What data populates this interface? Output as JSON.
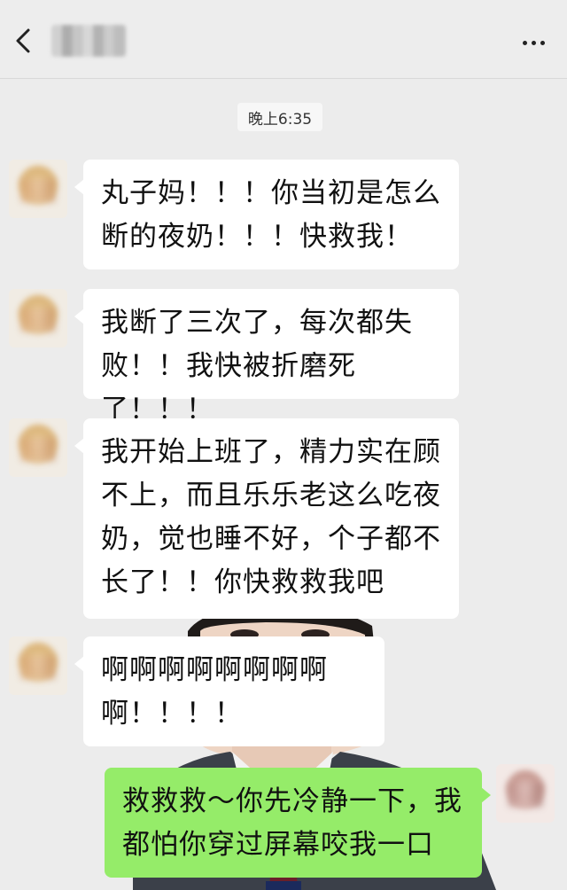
{
  "header": {
    "back_icon": "chevron-left-icon",
    "contact_name": "",
    "more_icon": "more-dots-icon"
  },
  "timestamp": "晚上6:35",
  "messages": [
    {
      "side": "left",
      "text": "丸子妈！！！你当初是怎么\n断的夜奶！！！快救我！"
    },
    {
      "side": "left",
      "text": "我断了三次了，每次都失\n败！！我快被折磨死了！！！"
    },
    {
      "side": "left",
      "text": "我开始上班了，精力实在顾\n不上，而且乐乐老这么吃夜\n奶，觉也睡不好，个子都不\n长了！！你快救救我吧"
    },
    {
      "side": "left",
      "text": "啊啊啊啊啊啊啊啊\n啊！！！！"
    },
    {
      "side": "right",
      "text": "救救救～你先冷静一下，我\n都怕你穿过屏幕咬我一口"
    }
  ],
  "colors": {
    "header_bg": "#ededed",
    "chat_bg": "#ececec",
    "incoming_bubble": "#ffffff",
    "outgoing_bubble": "#95ec69"
  }
}
